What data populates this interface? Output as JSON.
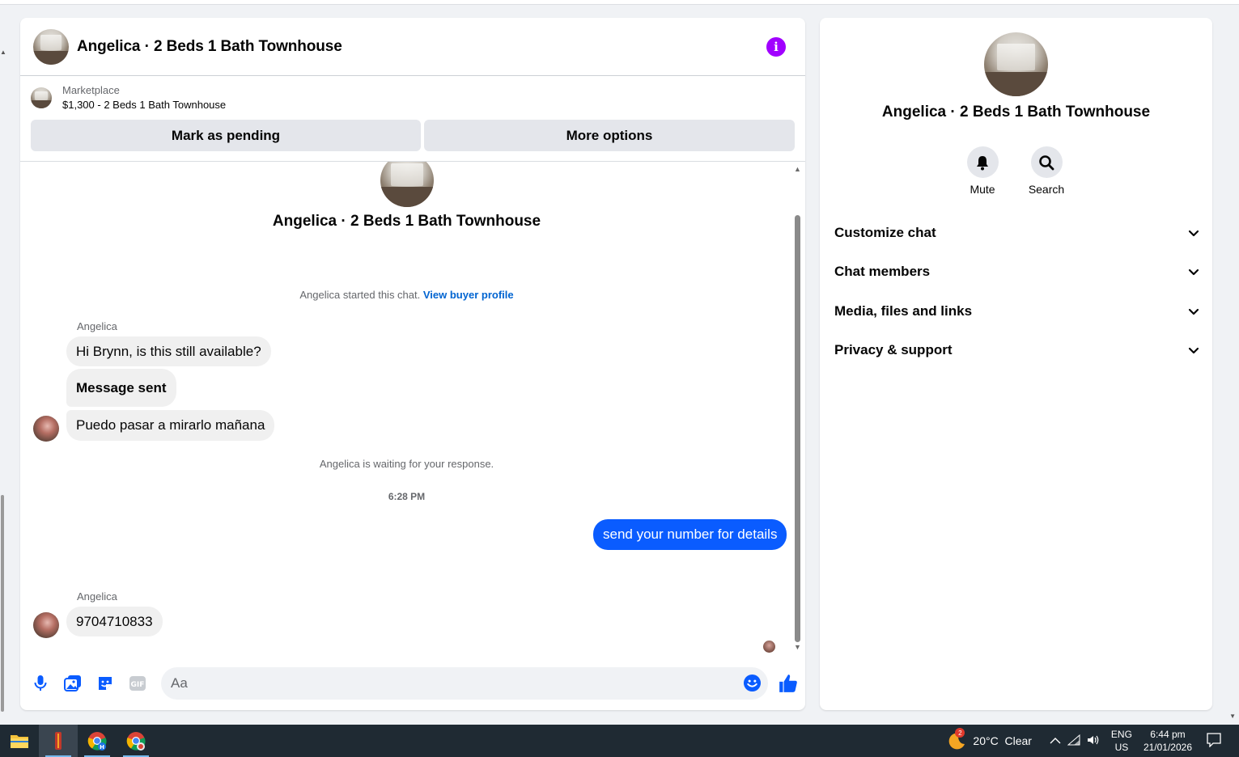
{
  "chat": {
    "header_title": "Angelica · 2 Beds 1 Bath Townhouse",
    "marketplace_label": "Marketplace",
    "listing": "$1,300 - 2 Beds 1 Bath Townhouse",
    "mark_pending": "Mark as pending",
    "more_options": "More options",
    "thread_title": "Angelica · 2 Beds 1 Bath Townhouse",
    "started_text": "Angelica started this chat.",
    "view_buyer_profile": "View buyer profile",
    "messages": [
      {
        "sender": "Angelica",
        "text": "Hi Brynn, is this still available?"
      },
      {
        "text": "Message sent"
      },
      {
        "text": "Puedo pasar a mirarlo mañana"
      }
    ],
    "waiting_text": "Angelica is waiting for your response.",
    "timestamp": "6:28 PM",
    "outgoing": "send your number for details",
    "reply_sender": "Angelica",
    "reply_text": "9704710833",
    "composer_placeholder": "Aa"
  },
  "info": {
    "title": "Angelica · 2 Beds 1 Bath Townhouse",
    "mute_label": "Mute",
    "search_label": "Search",
    "sections": [
      "Customize chat",
      "Chat members",
      "Media, files and links",
      "Privacy & support"
    ]
  },
  "taskbar": {
    "weather_badge": "2",
    "weather": "20°C  Clear",
    "lang_top": "ENG",
    "lang_bottom": "US",
    "time": "6:44 pm",
    "date": "21/01/2026"
  },
  "colors": {
    "accent": "#0a5cff",
    "info_icon": "#a100ff",
    "link": "#0064d1"
  }
}
